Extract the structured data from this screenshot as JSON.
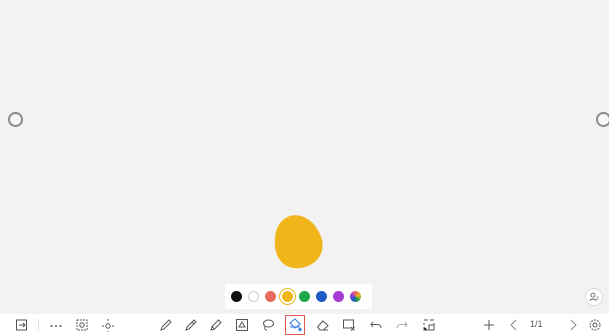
{
  "canvas": {
    "background": "#f2f2f2",
    "stroke_color": "#f0b51b"
  },
  "palette": {
    "colors": [
      "#111111",
      "#ffffff",
      "#e86a5e",
      "#f0b51b",
      "#1fa84a",
      "#1e5bc6",
      "#a83ad6",
      "rainbow"
    ],
    "selected": "#f0b51b"
  },
  "toolbar": {
    "icons": [
      "switch-board-icon",
      "more-icon",
      "sticker-icon",
      "pan-icon",
      "pen-icon",
      "highlighter-icon",
      "marker-icon",
      "shape-icon",
      "lasso-icon",
      "fill-icon",
      "eraser-icon",
      "clear-icon",
      "undo-icon",
      "redo-icon",
      "grid-select-icon",
      "add-page-icon",
      "prev-page-icon",
      "next-page-icon",
      "settings-icon"
    ],
    "page_indicator": "1/1"
  }
}
